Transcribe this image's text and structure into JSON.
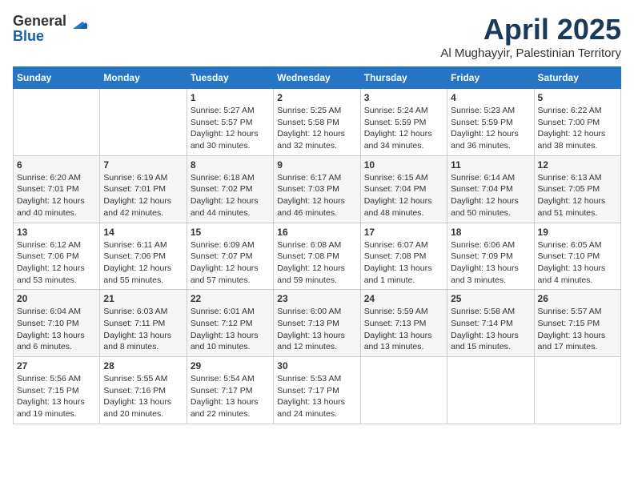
{
  "logo": {
    "general": "General",
    "blue": "Blue"
  },
  "title": "April 2025",
  "subtitle": "Al Mughayyir, Palestinian Territory",
  "days_of_week": [
    "Sunday",
    "Monday",
    "Tuesday",
    "Wednesday",
    "Thursday",
    "Friday",
    "Saturday"
  ],
  "weeks": [
    [
      {
        "day": "",
        "info": ""
      },
      {
        "day": "",
        "info": ""
      },
      {
        "day": "1",
        "info": "Sunrise: 5:27 AM\nSunset: 5:57 PM\nDaylight: 12 hours and 30 minutes."
      },
      {
        "day": "2",
        "info": "Sunrise: 5:25 AM\nSunset: 5:58 PM\nDaylight: 12 hours and 32 minutes."
      },
      {
        "day": "3",
        "info": "Sunrise: 5:24 AM\nSunset: 5:59 PM\nDaylight: 12 hours and 34 minutes."
      },
      {
        "day": "4",
        "info": "Sunrise: 5:23 AM\nSunset: 5:59 PM\nDaylight: 12 hours and 36 minutes."
      },
      {
        "day": "5",
        "info": "Sunrise: 6:22 AM\nSunset: 7:00 PM\nDaylight: 12 hours and 38 minutes."
      }
    ],
    [
      {
        "day": "6",
        "info": "Sunrise: 6:20 AM\nSunset: 7:01 PM\nDaylight: 12 hours and 40 minutes."
      },
      {
        "day": "7",
        "info": "Sunrise: 6:19 AM\nSunset: 7:01 PM\nDaylight: 12 hours and 42 minutes."
      },
      {
        "day": "8",
        "info": "Sunrise: 6:18 AM\nSunset: 7:02 PM\nDaylight: 12 hours and 44 minutes."
      },
      {
        "day": "9",
        "info": "Sunrise: 6:17 AM\nSunset: 7:03 PM\nDaylight: 12 hours and 46 minutes."
      },
      {
        "day": "10",
        "info": "Sunrise: 6:15 AM\nSunset: 7:04 PM\nDaylight: 12 hours and 48 minutes."
      },
      {
        "day": "11",
        "info": "Sunrise: 6:14 AM\nSunset: 7:04 PM\nDaylight: 12 hours and 50 minutes."
      },
      {
        "day": "12",
        "info": "Sunrise: 6:13 AM\nSunset: 7:05 PM\nDaylight: 12 hours and 51 minutes."
      }
    ],
    [
      {
        "day": "13",
        "info": "Sunrise: 6:12 AM\nSunset: 7:06 PM\nDaylight: 12 hours and 53 minutes."
      },
      {
        "day": "14",
        "info": "Sunrise: 6:11 AM\nSunset: 7:06 PM\nDaylight: 12 hours and 55 minutes."
      },
      {
        "day": "15",
        "info": "Sunrise: 6:09 AM\nSunset: 7:07 PM\nDaylight: 12 hours and 57 minutes."
      },
      {
        "day": "16",
        "info": "Sunrise: 6:08 AM\nSunset: 7:08 PM\nDaylight: 12 hours and 59 minutes."
      },
      {
        "day": "17",
        "info": "Sunrise: 6:07 AM\nSunset: 7:08 PM\nDaylight: 13 hours and 1 minute."
      },
      {
        "day": "18",
        "info": "Sunrise: 6:06 AM\nSunset: 7:09 PM\nDaylight: 13 hours and 3 minutes."
      },
      {
        "day": "19",
        "info": "Sunrise: 6:05 AM\nSunset: 7:10 PM\nDaylight: 13 hours and 4 minutes."
      }
    ],
    [
      {
        "day": "20",
        "info": "Sunrise: 6:04 AM\nSunset: 7:10 PM\nDaylight: 13 hours and 6 minutes."
      },
      {
        "day": "21",
        "info": "Sunrise: 6:03 AM\nSunset: 7:11 PM\nDaylight: 13 hours and 8 minutes."
      },
      {
        "day": "22",
        "info": "Sunrise: 6:01 AM\nSunset: 7:12 PM\nDaylight: 13 hours and 10 minutes."
      },
      {
        "day": "23",
        "info": "Sunrise: 6:00 AM\nSunset: 7:13 PM\nDaylight: 13 hours and 12 minutes."
      },
      {
        "day": "24",
        "info": "Sunrise: 5:59 AM\nSunset: 7:13 PM\nDaylight: 13 hours and 13 minutes."
      },
      {
        "day": "25",
        "info": "Sunrise: 5:58 AM\nSunset: 7:14 PM\nDaylight: 13 hours and 15 minutes."
      },
      {
        "day": "26",
        "info": "Sunrise: 5:57 AM\nSunset: 7:15 PM\nDaylight: 13 hours and 17 minutes."
      }
    ],
    [
      {
        "day": "27",
        "info": "Sunrise: 5:56 AM\nSunset: 7:15 PM\nDaylight: 13 hours and 19 minutes."
      },
      {
        "day": "28",
        "info": "Sunrise: 5:55 AM\nSunset: 7:16 PM\nDaylight: 13 hours and 20 minutes."
      },
      {
        "day": "29",
        "info": "Sunrise: 5:54 AM\nSunset: 7:17 PM\nDaylight: 13 hours and 22 minutes."
      },
      {
        "day": "30",
        "info": "Sunrise: 5:53 AM\nSunset: 7:17 PM\nDaylight: 13 hours and 24 minutes."
      },
      {
        "day": "",
        "info": ""
      },
      {
        "day": "",
        "info": ""
      },
      {
        "day": "",
        "info": ""
      }
    ]
  ]
}
